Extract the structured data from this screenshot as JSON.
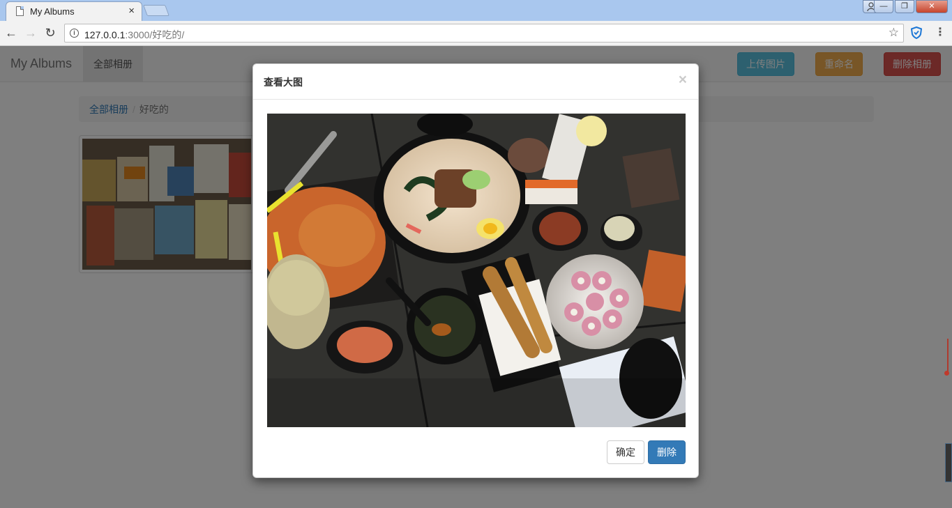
{
  "browser": {
    "tab_title": "My Albums",
    "tab_close": "×",
    "url_host": "127.0.0.1",
    "url_path": ":3000/好吃的/",
    "info_glyph": "i",
    "star_glyph": "☆",
    "menu_glyph": "⋮",
    "back_glyph": "←",
    "forward_glyph": "→",
    "reload_glyph": "↻",
    "window": {
      "min": "—",
      "max": "❐",
      "close": "✕"
    }
  },
  "navbar": {
    "brand": "My Albums",
    "active_link": "全部相册",
    "upload_button": "上传图片",
    "rename_button": "重命名",
    "delete_album_button": "删除相册"
  },
  "breadcrumb": {
    "home": "全部相册",
    "separator": "/",
    "current": "好吃的"
  },
  "modal": {
    "title": "查看大图",
    "close": "×",
    "confirm_button": "确定",
    "delete_button": "删除"
  },
  "colors": {
    "primary": "#337ab7",
    "info": "#5bc0de",
    "warning": "#f0ad4e",
    "danger": "#d9534f"
  },
  "icons": [
    "page-icon",
    "back-icon",
    "forward-icon",
    "reload-icon",
    "info-icon",
    "star-icon",
    "shield-icon",
    "menu-icon",
    "close-icon"
  ]
}
